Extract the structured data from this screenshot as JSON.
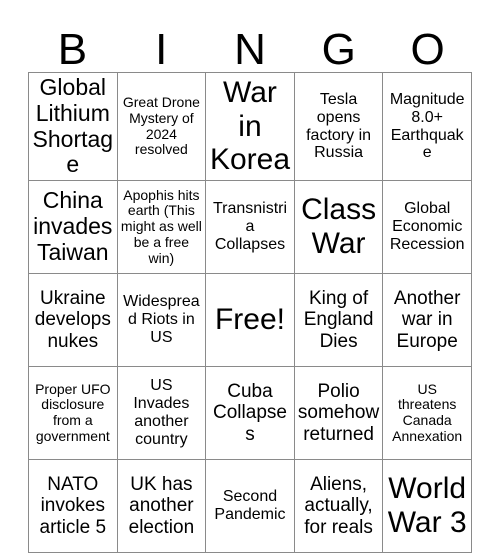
{
  "header": {
    "letters": [
      "B",
      "I",
      "N",
      "G",
      "O"
    ]
  },
  "grid": {
    "rows": [
      [
        {
          "text": "Global Lithium Shortage",
          "size": "fs-lg"
        },
        {
          "text": "Great Drone Mystery of 2024 resolved",
          "size": "fs-xs"
        },
        {
          "text": "War in Korea",
          "size": "fs-xl"
        },
        {
          "text": "Tesla opens factory in Russia",
          "size": "fs-sm"
        },
        {
          "text": "Magnitude 8.0+ Earthquake",
          "size": "fs-sm"
        }
      ],
      [
        {
          "text": "China invades Taiwan",
          "size": "fs-lg"
        },
        {
          "text": "Apophis hits earth (This might as well be a free win)",
          "size": "fs-xs"
        },
        {
          "text": "Transnistria Collapses",
          "size": "fs-sm"
        },
        {
          "text": "Class War",
          "size": "fs-xl"
        },
        {
          "text": "Global Economic Recession",
          "size": "fs-sm"
        }
      ],
      [
        {
          "text": "Ukraine develops nukes",
          "size": "fs-md"
        },
        {
          "text": "Widespread Riots in US",
          "size": "fs-sm"
        },
        {
          "text": "Free!",
          "size": "fs-xl"
        },
        {
          "text": "King of England Dies",
          "size": "fs-md"
        },
        {
          "text": "Another war in Europe",
          "size": "fs-md"
        }
      ],
      [
        {
          "text": "Proper UFO disclosure from a government",
          "size": "fs-xs"
        },
        {
          "text": "US Invades another country",
          "size": "fs-sm"
        },
        {
          "text": "Cuba Collapses",
          "size": "fs-md"
        },
        {
          "text": "Polio somehow returned",
          "size": "fs-md"
        },
        {
          "text": "US threatens Canada Annexation",
          "size": "fs-xs"
        }
      ],
      [
        {
          "text": "NATO invokes article 5",
          "size": "fs-md"
        },
        {
          "text": "UK has another election",
          "size": "fs-md"
        },
        {
          "text": "Second Pandemic",
          "size": "fs-sm"
        },
        {
          "text": "Aliens, actually, for reals",
          "size": "fs-md"
        },
        {
          "text": "World War 3",
          "size": "fs-xl"
        }
      ]
    ]
  }
}
